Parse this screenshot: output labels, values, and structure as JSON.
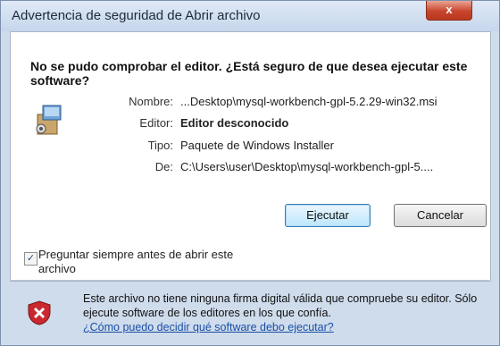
{
  "window": {
    "title": "Advertencia de seguridad de Abrir archivo",
    "close_glyph": "x"
  },
  "dialog": {
    "heading": "No se pudo comprobar el editor. ¿Está seguro de que desea ejecutar este software?",
    "fields": [
      {
        "label": "Nombre:",
        "value": "...Desktop\\mysql-workbench-gpl-5.2.29-win32.msi"
      },
      {
        "label": "Editor:",
        "value": "Editor desconocido"
      },
      {
        "label": "Tipo:",
        "value": "Paquete de Windows Installer"
      },
      {
        "label": "De:",
        "value": "C:\\Users\\user\\Desktop\\mysql-workbench-gpl-5...."
      }
    ],
    "buttons": {
      "run": "Ejecutar",
      "cancel": "Cancelar"
    },
    "checkbox": {
      "label": "Preguntar siempre antes de abrir este archivo",
      "checked": true
    }
  },
  "footer": {
    "warning": "Este archivo no tiene ninguna firma digital válida que compruebe su editor. Sólo ejecute software de los editores en los que confía.",
    "link": "¿Cómo puedo decidir qué software debo ejecutar?"
  },
  "icons": {
    "package": "installer-package-icon",
    "warning": "shield-warning-icon"
  }
}
